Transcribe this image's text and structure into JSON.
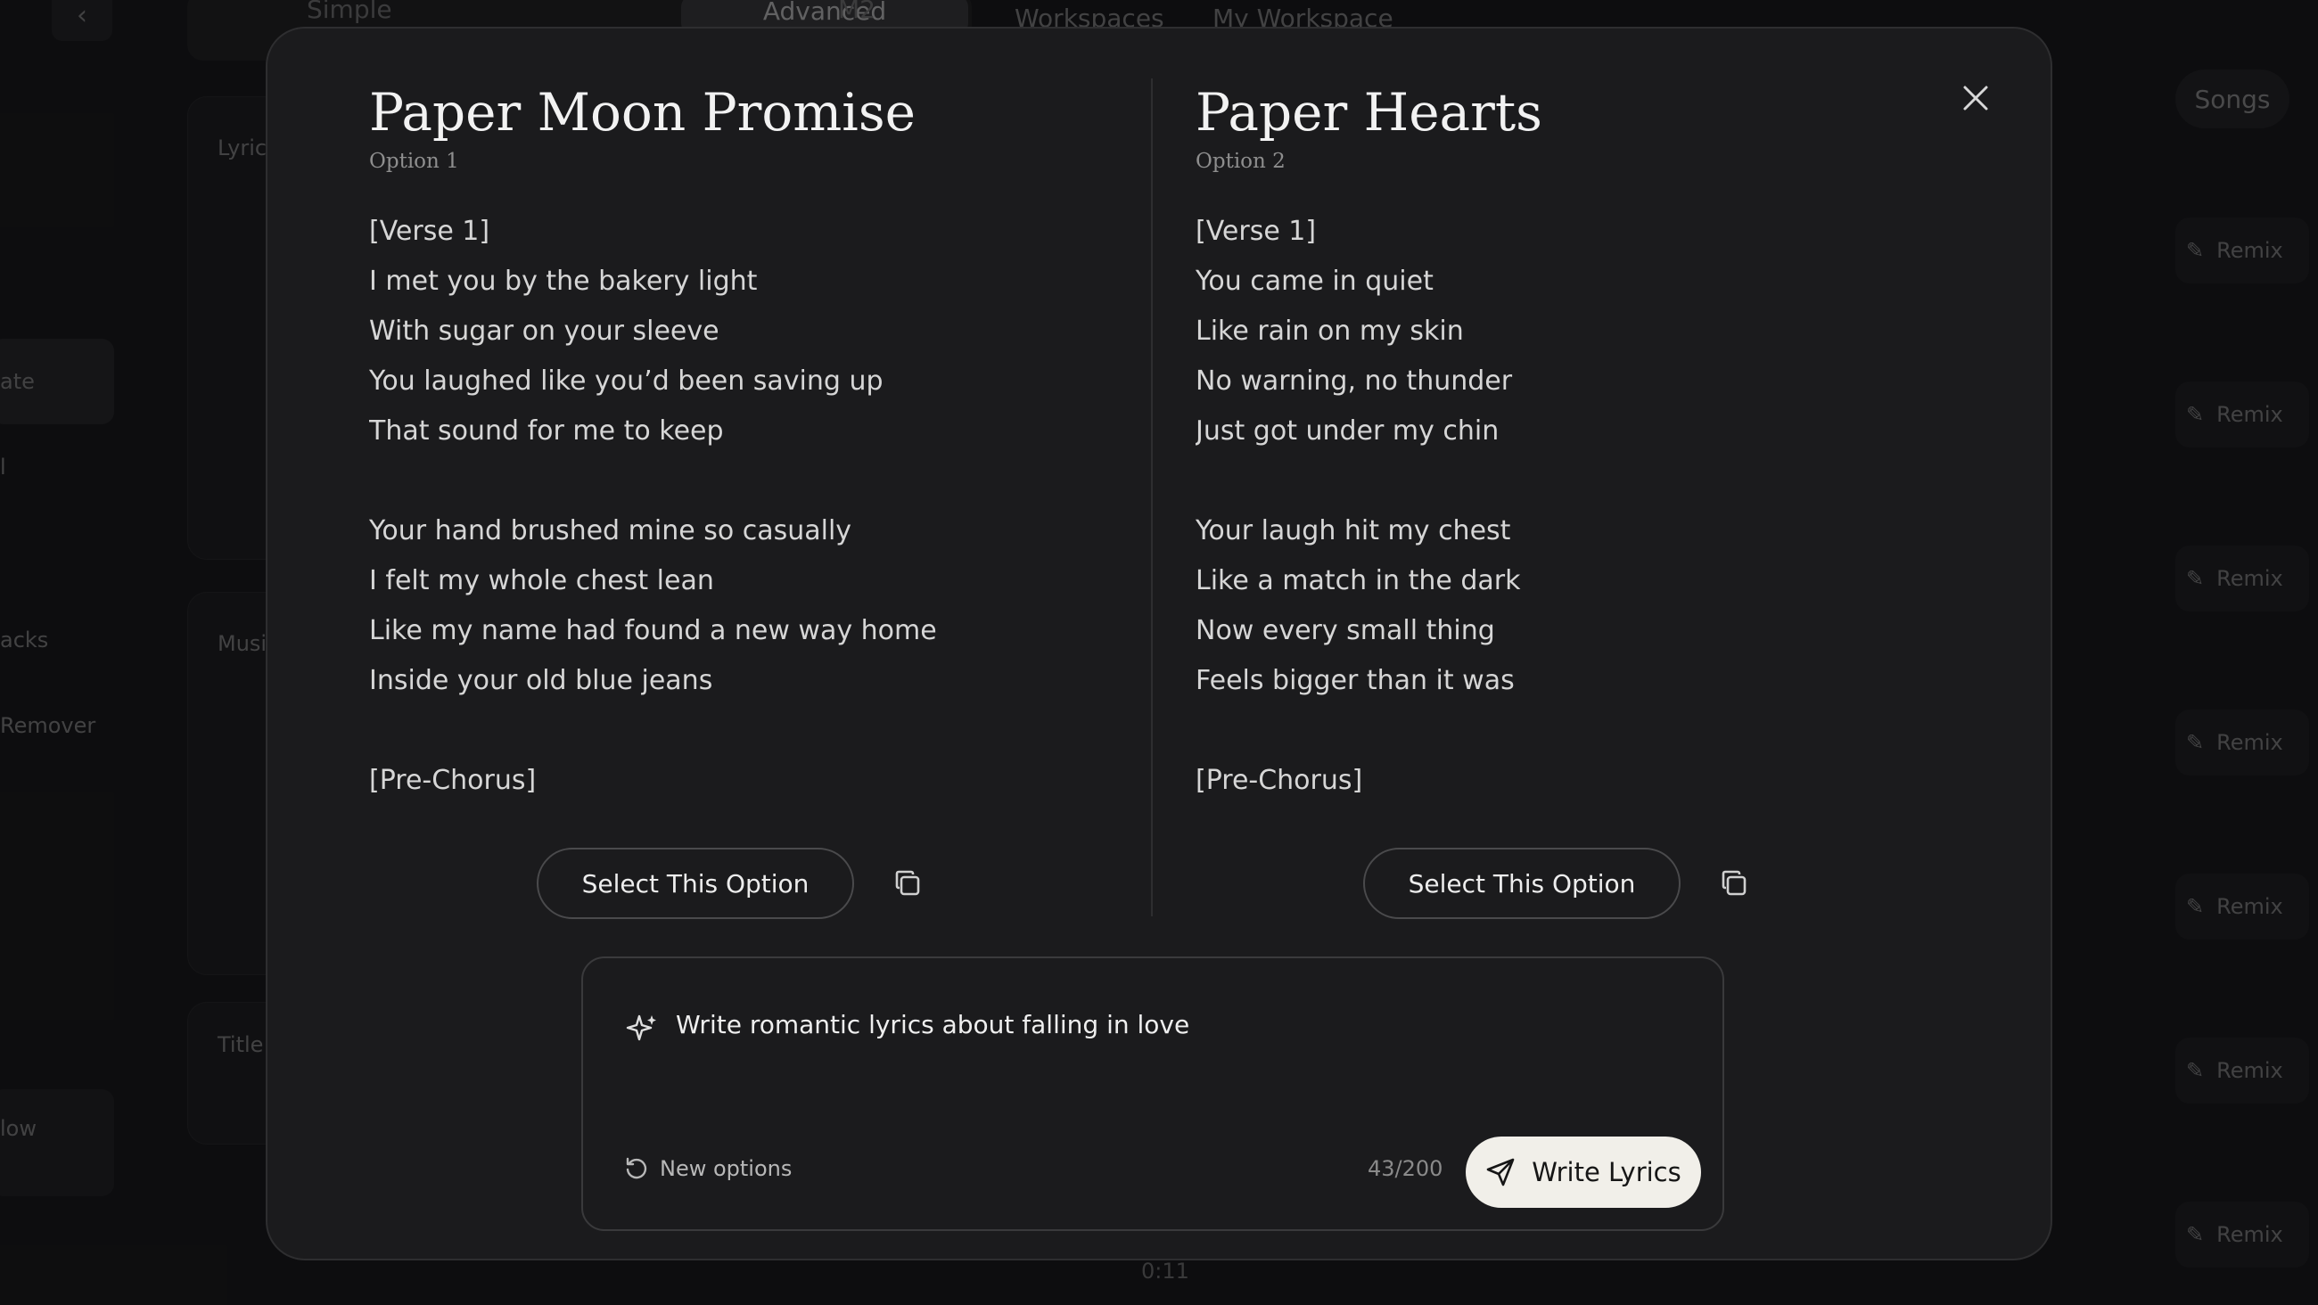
{
  "background": {
    "mode_tabs": [
      "Simple",
      "Advanced",
      "M2"
    ],
    "breadcrumb": [
      "Workspaces",
      "My Workspace"
    ],
    "sidebar_items": [
      "ate",
      "l",
      "acks",
      "Remover",
      "low"
    ],
    "panel_labels": [
      "Lyric",
      "Musi",
      "Title"
    ],
    "songs_label": "Songs",
    "remix_label": "Remix",
    "time_label": "0:11"
  },
  "modal": {
    "options": [
      {
        "title": "Paper Moon Promise",
        "subtitle": "Option 1",
        "lines": [
          "[Verse 1]",
          "I met you by the bakery light",
          "With sugar on your sleeve",
          "You laughed like you’d been saving up",
          "That sound for me to keep",
          "",
          "Your hand brushed mine so casually",
          "I felt my whole chest lean",
          "Like my name had found a new way home",
          "Inside your old blue jeans",
          "",
          "[Pre-Chorus]"
        ],
        "select_label": "Select This Option"
      },
      {
        "title": "Paper Hearts",
        "subtitle": "Option 2",
        "lines": [
          "[Verse 1]",
          "You came in quiet",
          "Like rain on my skin",
          "No warning, no thunder",
          "Just got under my chin",
          "",
          "Your laugh hit my chest",
          "Like a match in the dark",
          "Now every small thing",
          "Feels bigger than it was",
          "",
          "[Pre-Chorus]"
        ],
        "select_label": "Select This Option"
      }
    ],
    "prompt": {
      "text": "Write romantic lyrics about falling in love",
      "new_options_label": "New options",
      "char_count": "43/200",
      "write_label": "Write Lyrics"
    }
  },
  "icons": [
    "close-icon",
    "copy-icon",
    "sparkle-icon",
    "refresh-icon",
    "send-icon",
    "chevron-left-icon",
    "wand-icon"
  ],
  "colors": {
    "backdrop": "#161617",
    "modal": "#1b1b1d",
    "primary_button": "#f1efe9"
  }
}
